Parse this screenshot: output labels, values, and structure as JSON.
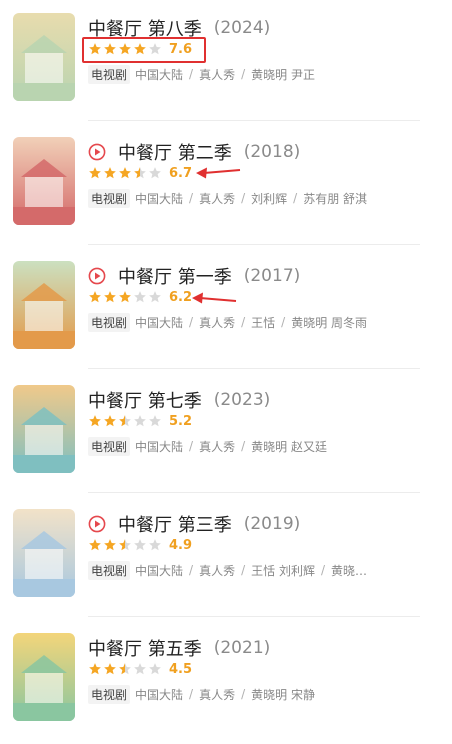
{
  "colors": {
    "star_filled": "#f5a623",
    "star_empty": "#d9d9d9",
    "score": "#f0a020",
    "play_icon": "#e5484d",
    "annotation": "#e03030"
  },
  "items": [
    {
      "title": "中餐厅  第八季",
      "year": "(2024)",
      "stars": 4,
      "score": "7.6",
      "has_play": false,
      "badge": "电视剧",
      "meta": [
        "中国大陆",
        "真人秀",
        "黄晓明  尹正"
      ],
      "poster_palette": [
        "#b9d4b0",
        "#e8dcae"
      ]
    },
    {
      "title": "中餐厅  第二季",
      "year": "(2018)",
      "stars": 3.5,
      "score": "6.7",
      "has_play": true,
      "badge": "电视剧",
      "meta": [
        "中国大陆",
        "真人秀",
        "刘利辉",
        "苏有朋  舒淇"
      ],
      "poster_palette": [
        "#d46a6a",
        "#f1d0b8"
      ]
    },
    {
      "title": "中餐厅  第一季",
      "year": "(2017)",
      "stars": 3,
      "score": "6.2",
      "has_play": true,
      "badge": "电视剧",
      "meta": [
        "中国大陆",
        "真人秀",
        "王恬",
        "黄晓明  周冬雨"
      ],
      "poster_palette": [
        "#e39a4a",
        "#cbe0c0"
      ]
    },
    {
      "title": "中餐厅  第七季",
      "year": "(2023)",
      "stars": 2.5,
      "score": "5.2",
      "has_play": false,
      "badge": "电视剧",
      "meta": [
        "中国大陆",
        "真人秀",
        "黄晓明  赵又廷"
      ],
      "poster_palette": [
        "#7fbfc0",
        "#f0c98a"
      ]
    },
    {
      "title": "中餐厅  第三季",
      "year": "(2019)",
      "stars": 2.5,
      "score": "4.9",
      "has_play": true,
      "badge": "电视剧",
      "meta": [
        "中国大陆",
        "真人秀",
        "王恬  刘利辉",
        "黄晓…"
      ],
      "poster_palette": [
        "#a8c8e0",
        "#f2e2c8"
      ]
    },
    {
      "title": "中餐厅  第五季",
      "year": "(2021)",
      "stars": 2.5,
      "score": "4.5",
      "has_play": false,
      "badge": "电视剧",
      "meta": [
        "中国大陆",
        "真人秀",
        "黄晓明  宋静"
      ],
      "poster_palette": [
        "#8ac6a0",
        "#f3d57a"
      ]
    }
  ]
}
